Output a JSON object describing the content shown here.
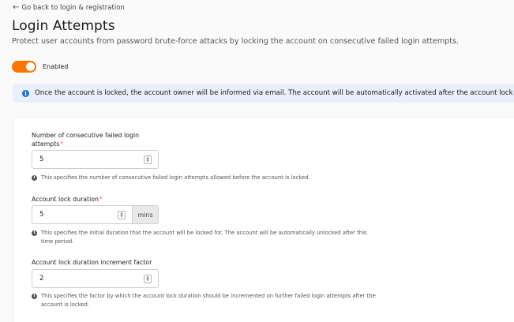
{
  "back_link": {
    "arrow": "←",
    "label": "Go back to login & registration"
  },
  "header": {
    "title": "Login Attempts",
    "description": "Protect user accounts from password brute-force attacks by locking the account on consecutive failed login attempts."
  },
  "toggle": {
    "label": "Enabled",
    "on": true,
    "color": "#ff7300"
  },
  "info_banner": {
    "icon": "info-icon",
    "text": "Once the account is locked, the account owner will be informed via email. The account will be automatically activated after the account lock duration.",
    "color": "#e9f0fb"
  },
  "fields": [
    {
      "label_line1": "Number of consecutive failed login",
      "label_line2": "attempts",
      "required": "*",
      "value": "5",
      "hint": "This specifies the number of consecutive failed login attempts allowed before the account is locked."
    },
    {
      "label": "Account lock duration",
      "required": "*",
      "value": "5",
      "addon": "mins",
      "hint": "This specifies the initial duration that the account will be locked for. The account will be automatically unlocked after this time period."
    },
    {
      "label": "Account lock duration increment factor",
      "value": "2",
      "hint": "This specifies the factor by which the account lock duration should be incremented on further failed login attempts after the account is locked."
    }
  ]
}
